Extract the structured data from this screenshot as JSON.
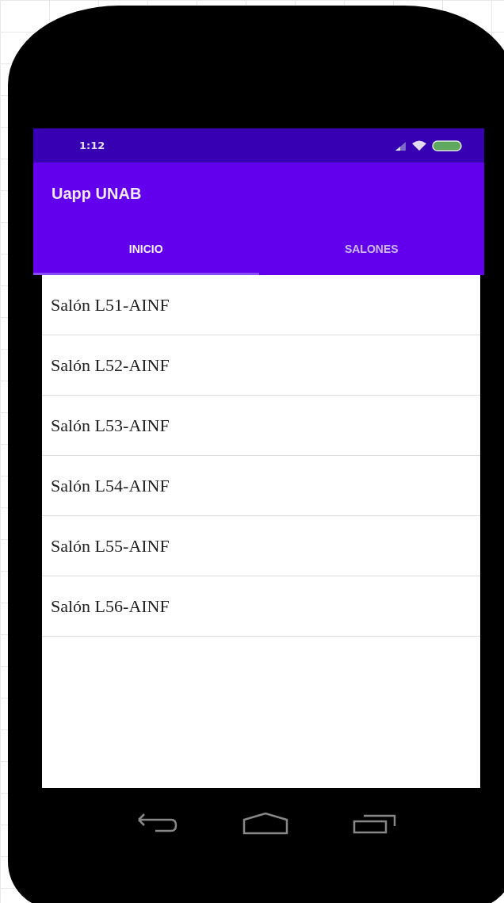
{
  "status_bar": {
    "time": "1:12"
  },
  "app_bar": {
    "title": "Uapp UNAB"
  },
  "tabs": [
    {
      "label": "INICIO",
      "selected": true
    },
    {
      "label": "SALONES",
      "selected": false
    }
  ],
  "list": {
    "items": [
      "Salón L51-AINF",
      "Salón L52-AINF",
      "Salón L53-AINF",
      "Salón L54-AINF",
      "Salón L55-AINF",
      "Salón L56-AINF"
    ]
  }
}
